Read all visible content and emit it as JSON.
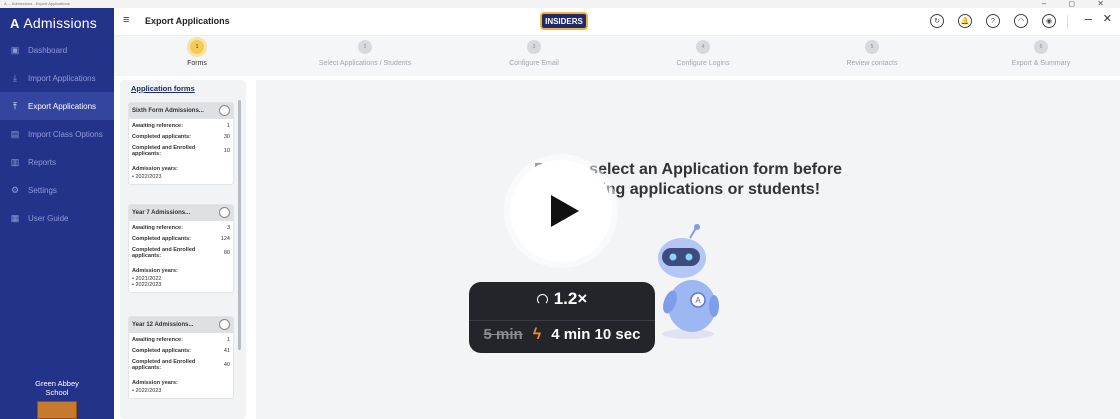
{
  "os": {
    "title_text": "A ... Admissions - Export Applications",
    "controls": "– ◻ ✕"
  },
  "brand": {
    "logo": "A",
    "name": "Admissions"
  },
  "sidebar": {
    "items": [
      {
        "label": "Dashboard",
        "icon": "dashboard-icon",
        "glyph": "▣"
      },
      {
        "label": "Import Applications",
        "icon": "import-icon",
        "glyph": "⤓"
      },
      {
        "label": "Export Applications",
        "icon": "export-icon",
        "glyph": "⤒"
      },
      {
        "label": "Import Class Options",
        "icon": "class-icon",
        "glyph": "▤"
      },
      {
        "label": "Reports",
        "icon": "reports-icon",
        "glyph": "▥"
      },
      {
        "label": "Settings",
        "icon": "settings-icon",
        "glyph": "⚙"
      },
      {
        "label": "User Guide",
        "icon": "guide-icon",
        "glyph": "▦"
      }
    ],
    "active_index": 2,
    "school_line1": "Green Abbey",
    "school_line2": "School"
  },
  "header": {
    "title": "Export Applications",
    "badge": "INSIDERS",
    "icons": [
      "sync-icon",
      "bell-icon",
      "help-icon",
      "support-icon",
      "account-icon"
    ],
    "icon_glyphs": [
      "↻",
      "🔔",
      "?",
      "◠",
      "◉"
    ]
  },
  "stepper": {
    "steps": [
      {
        "num": "1",
        "label": "Forms"
      },
      {
        "num": "2",
        "label": "Select Applications / Students"
      },
      {
        "num": "3",
        "label": "Configure Email"
      },
      {
        "num": "4",
        "label": "Configure Logins"
      },
      {
        "num": "5",
        "label": "Review contacts"
      },
      {
        "num": "6",
        "label": "Export & Summary"
      }
    ],
    "active_index": 0
  },
  "forms_panel": {
    "title": "Application forms",
    "cards": [
      {
        "name": "Sixth Form Admissions...",
        "awaiting_label": "Awaiting reference:",
        "awaiting": "1",
        "completed_label": "Completed applicants:",
        "completed": "30",
        "enrolled_label": "Completed and Enrolled applicants:",
        "enrolled": "10",
        "years_label": "Admission years:",
        "years": [
          "2022/2023"
        ]
      },
      {
        "name": "Year 7 Admissions...",
        "awaiting_label": "Awaiting reference:",
        "awaiting": "3",
        "completed_label": "Completed applicants:",
        "completed": "124",
        "enrolled_label": "Completed and Enrolled applicants:",
        "enrolled": "80",
        "years_label": "Admission years:",
        "years": [
          "2021/2022",
          "2022/2023"
        ]
      },
      {
        "name": "Year 12 Admissions...",
        "awaiting_label": "Awaiting reference:",
        "awaiting": "1",
        "completed_label": "Completed applicants:",
        "completed": "41",
        "enrolled_label": "Completed and Enrolled applicants:",
        "enrolled": "40",
        "years_label": "Admission years:",
        "years": [
          "2022/2023"
        ]
      }
    ]
  },
  "main": {
    "message_line1": "Please select an Application form before",
    "message_line2": "selecting applications or students!"
  },
  "video_overlay": {
    "speed": "1.2×",
    "original_duration": "5 min",
    "new_duration": "4 min 10 sec",
    "colors": {
      "bolt": "#f08a2a",
      "badge_bg": "#23252a"
    }
  },
  "colors": {
    "sidebar_bg": "#23338a",
    "accent": "#f4ca5b",
    "badge_bg": "#1d2b6b"
  }
}
